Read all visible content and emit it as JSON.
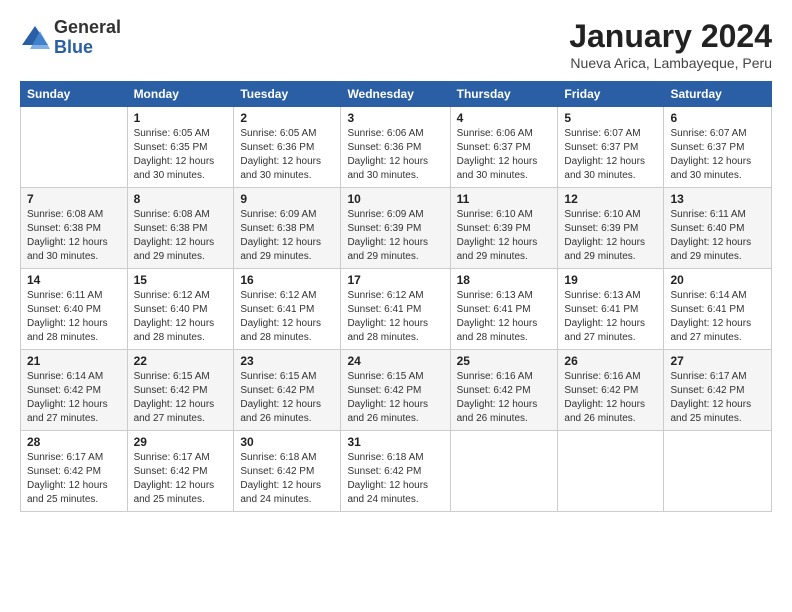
{
  "logo": {
    "general": "General",
    "blue": "Blue"
  },
  "title": "January 2024",
  "subtitle": "Nueva Arica, Lambayeque, Peru",
  "header_days": [
    "Sunday",
    "Monday",
    "Tuesday",
    "Wednesday",
    "Thursday",
    "Friday",
    "Saturday"
  ],
  "weeks": [
    [
      {
        "day": "",
        "info": ""
      },
      {
        "day": "1",
        "info": "Sunrise: 6:05 AM\nSunset: 6:35 PM\nDaylight: 12 hours\nand 30 minutes."
      },
      {
        "day": "2",
        "info": "Sunrise: 6:05 AM\nSunset: 6:36 PM\nDaylight: 12 hours\nand 30 minutes."
      },
      {
        "day": "3",
        "info": "Sunrise: 6:06 AM\nSunset: 6:36 PM\nDaylight: 12 hours\nand 30 minutes."
      },
      {
        "day": "4",
        "info": "Sunrise: 6:06 AM\nSunset: 6:37 PM\nDaylight: 12 hours\nand 30 minutes."
      },
      {
        "day": "5",
        "info": "Sunrise: 6:07 AM\nSunset: 6:37 PM\nDaylight: 12 hours\nand 30 minutes."
      },
      {
        "day": "6",
        "info": "Sunrise: 6:07 AM\nSunset: 6:37 PM\nDaylight: 12 hours\nand 30 minutes."
      }
    ],
    [
      {
        "day": "7",
        "info": "Sunrise: 6:08 AM\nSunset: 6:38 PM\nDaylight: 12 hours\nand 30 minutes."
      },
      {
        "day": "8",
        "info": "Sunrise: 6:08 AM\nSunset: 6:38 PM\nDaylight: 12 hours\nand 29 minutes."
      },
      {
        "day": "9",
        "info": "Sunrise: 6:09 AM\nSunset: 6:38 PM\nDaylight: 12 hours\nand 29 minutes."
      },
      {
        "day": "10",
        "info": "Sunrise: 6:09 AM\nSunset: 6:39 PM\nDaylight: 12 hours\nand 29 minutes."
      },
      {
        "day": "11",
        "info": "Sunrise: 6:10 AM\nSunset: 6:39 PM\nDaylight: 12 hours\nand 29 minutes."
      },
      {
        "day": "12",
        "info": "Sunrise: 6:10 AM\nSunset: 6:39 PM\nDaylight: 12 hours\nand 29 minutes."
      },
      {
        "day": "13",
        "info": "Sunrise: 6:11 AM\nSunset: 6:40 PM\nDaylight: 12 hours\nand 29 minutes."
      }
    ],
    [
      {
        "day": "14",
        "info": "Sunrise: 6:11 AM\nSunset: 6:40 PM\nDaylight: 12 hours\nand 28 minutes."
      },
      {
        "day": "15",
        "info": "Sunrise: 6:12 AM\nSunset: 6:40 PM\nDaylight: 12 hours\nand 28 minutes."
      },
      {
        "day": "16",
        "info": "Sunrise: 6:12 AM\nSunset: 6:41 PM\nDaylight: 12 hours\nand 28 minutes."
      },
      {
        "day": "17",
        "info": "Sunrise: 6:12 AM\nSunset: 6:41 PM\nDaylight: 12 hours\nand 28 minutes."
      },
      {
        "day": "18",
        "info": "Sunrise: 6:13 AM\nSunset: 6:41 PM\nDaylight: 12 hours\nand 28 minutes."
      },
      {
        "day": "19",
        "info": "Sunrise: 6:13 AM\nSunset: 6:41 PM\nDaylight: 12 hours\nand 27 minutes."
      },
      {
        "day": "20",
        "info": "Sunrise: 6:14 AM\nSunset: 6:41 PM\nDaylight: 12 hours\nand 27 minutes."
      }
    ],
    [
      {
        "day": "21",
        "info": "Sunrise: 6:14 AM\nSunset: 6:42 PM\nDaylight: 12 hours\nand 27 minutes."
      },
      {
        "day": "22",
        "info": "Sunrise: 6:15 AM\nSunset: 6:42 PM\nDaylight: 12 hours\nand 27 minutes."
      },
      {
        "day": "23",
        "info": "Sunrise: 6:15 AM\nSunset: 6:42 PM\nDaylight: 12 hours\nand 26 minutes."
      },
      {
        "day": "24",
        "info": "Sunrise: 6:15 AM\nSunset: 6:42 PM\nDaylight: 12 hours\nand 26 minutes."
      },
      {
        "day": "25",
        "info": "Sunrise: 6:16 AM\nSunset: 6:42 PM\nDaylight: 12 hours\nand 26 minutes."
      },
      {
        "day": "26",
        "info": "Sunrise: 6:16 AM\nSunset: 6:42 PM\nDaylight: 12 hours\nand 26 minutes."
      },
      {
        "day": "27",
        "info": "Sunrise: 6:17 AM\nSunset: 6:42 PM\nDaylight: 12 hours\nand 25 minutes."
      }
    ],
    [
      {
        "day": "28",
        "info": "Sunrise: 6:17 AM\nSunset: 6:42 PM\nDaylight: 12 hours\nand 25 minutes."
      },
      {
        "day": "29",
        "info": "Sunrise: 6:17 AM\nSunset: 6:42 PM\nDaylight: 12 hours\nand 25 minutes."
      },
      {
        "day": "30",
        "info": "Sunrise: 6:18 AM\nSunset: 6:42 PM\nDaylight: 12 hours\nand 24 minutes."
      },
      {
        "day": "31",
        "info": "Sunrise: 6:18 AM\nSunset: 6:42 PM\nDaylight: 12 hours\nand 24 minutes."
      },
      {
        "day": "",
        "info": ""
      },
      {
        "day": "",
        "info": ""
      },
      {
        "day": "",
        "info": ""
      }
    ]
  ]
}
